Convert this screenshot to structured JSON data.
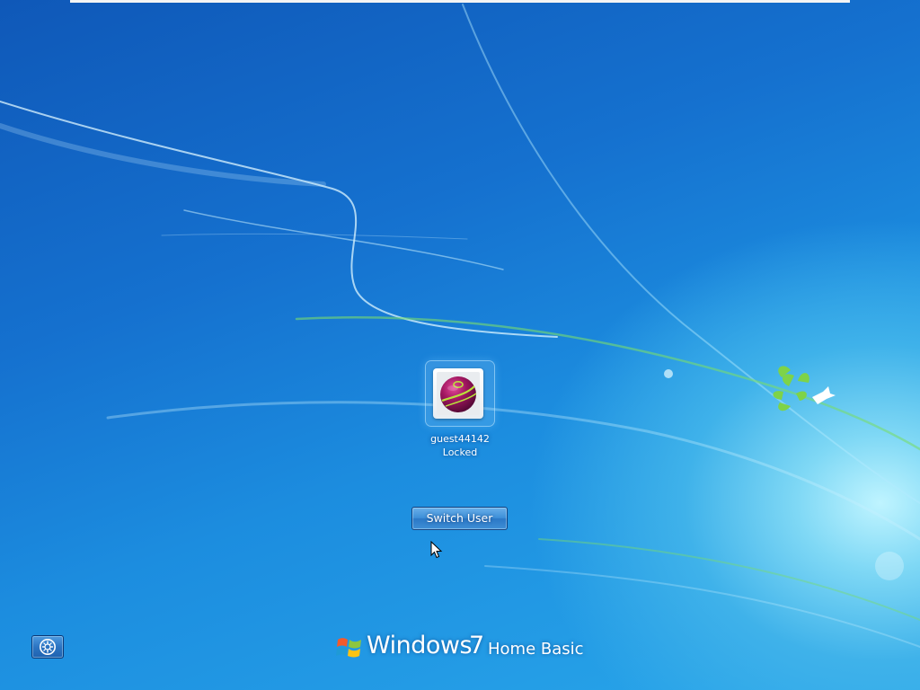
{
  "login": {
    "user_name": "guest44142",
    "user_status": "Locked",
    "switch_user_label": "Switch User"
  },
  "branding": {
    "windows": "Windows",
    "version": "7",
    "edition": "Home Basic"
  },
  "icons": {
    "user_avatar": "ball-avatar-icon",
    "ease_of_access": "ease-of-access-icon",
    "windows_logo": "windows-flag-icon",
    "cursor": "mouse-pointer-icon"
  },
  "colors": {
    "background_dark": "#0f58b8",
    "background_light": "#7fd8f5",
    "avatar_primary": "#a0165f",
    "avatar_stripe": "#b9e23b",
    "leaf_green": "#7ed348"
  }
}
